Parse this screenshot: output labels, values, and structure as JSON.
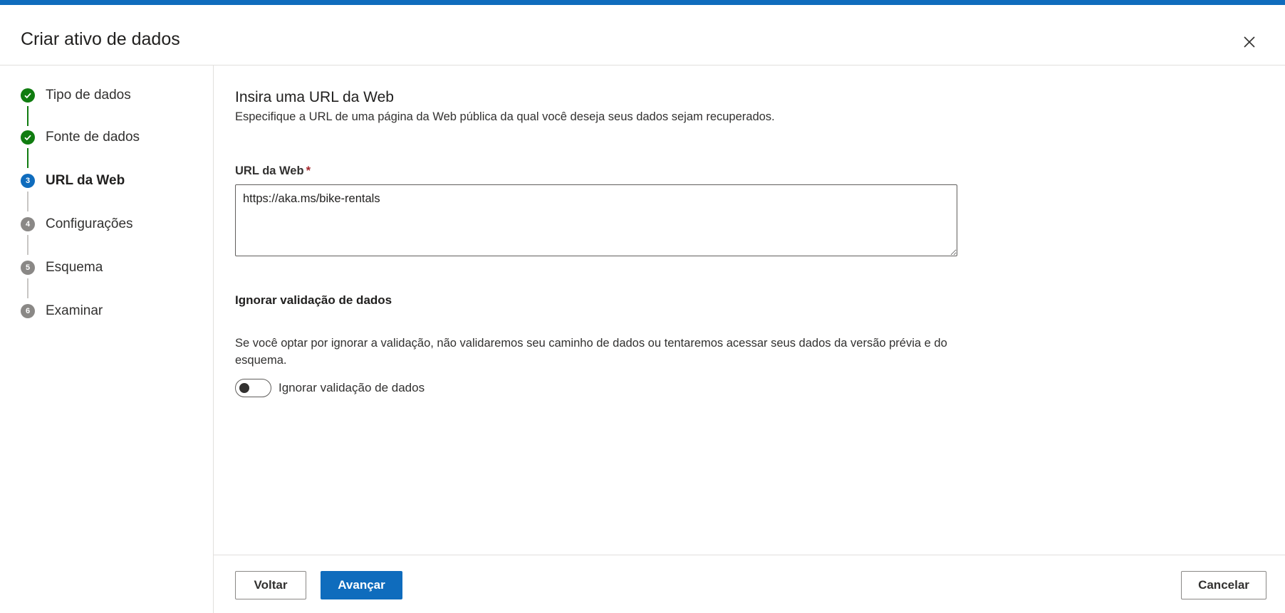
{
  "dialog": {
    "title": "Criar ativo de dados"
  },
  "steps": [
    {
      "number": "1",
      "label": "Tipo de dados",
      "status": "done"
    },
    {
      "number": "2",
      "label": "Fonte de dados",
      "status": "done"
    },
    {
      "number": "3",
      "label": "URL da Web",
      "status": "current"
    },
    {
      "number": "4",
      "label": "Configurações",
      "status": "pending"
    },
    {
      "number": "5",
      "label": "Esquema",
      "status": "pending"
    },
    {
      "number": "6",
      "label": "Examinar",
      "status": "pending"
    }
  ],
  "main": {
    "section_title": "Insira uma URL da Web",
    "section_desc": "Especifique a URL de uma página da Web pública da qual você deseja seus dados sejam recuperados.",
    "url_label": "URL da Web",
    "required_mark": "*",
    "url_value": "https://aka.ms/bike-rentals",
    "skip_heading": "Ignorar validação de dados",
    "skip_paragraph": "Se você optar por ignorar a validação, não validaremos seu caminho de dados ou tentaremos acessar seus dados da versão prévia e do esquema.",
    "toggle_label": "Ignorar validação de dados",
    "toggle_on": false
  },
  "footer": {
    "back_label": "Voltar",
    "next_label": "Avançar",
    "cancel_label": "Cancelar"
  },
  "colors": {
    "accent": "#0f6cbd",
    "success": "#107c10",
    "pending": "#8a8886",
    "required": "#a4262c"
  }
}
